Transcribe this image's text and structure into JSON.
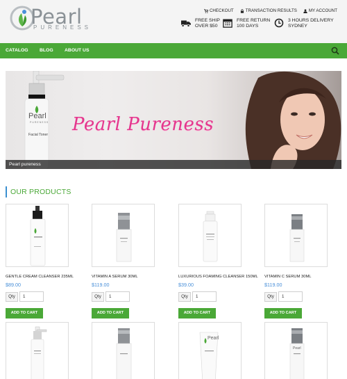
{
  "brand": {
    "name": "Pearl",
    "tagline": "PURENESS",
    "colors": {
      "green": "#4aa837",
      "price_blue": "#4a90d9",
      "banner_pink": "#e4368d"
    }
  },
  "top_links": [
    {
      "icon": "cart-icon",
      "label": "CHECKOUT"
    },
    {
      "icon": "lock-icon",
      "label": "TRANSACTION RESULTS"
    },
    {
      "icon": "user-icon",
      "label": "MY ACCOUNT"
    }
  ],
  "perks": [
    {
      "icon": "truck-icon",
      "line1": "FREE SHIP",
      "line2": "OVER $50"
    },
    {
      "icon": "calendar-icon",
      "line1": "FREE RETURN",
      "line2": "100 DAYS"
    },
    {
      "icon": "clock-icon",
      "line1": "3 HOURS DELIVERY",
      "line2": "SYDNEY"
    }
  ],
  "nav": {
    "items": [
      "CATALOG",
      "BLOG",
      "ABOUT US"
    ],
    "search_icon": "search-icon"
  },
  "banner": {
    "title": "Pearl Pureness",
    "bottle_label_brand": "Pearl",
    "bottle_label_sub": "PURENESS",
    "bottle_label_product": "Facial Toner",
    "caption": "Pearl pureness"
  },
  "section_title": "OUR PRODUCTS",
  "products": [
    {
      "name": "GENTLE CREAM CLEANSER 235ML",
      "price": "$89.00",
      "qty_label": "Qty",
      "qty_value": "1",
      "button": "ADD TO CART"
    },
    {
      "name": "VITAMIN A SERUM 30ML",
      "price": "$119.00",
      "qty_label": "Qty",
      "qty_value": "1",
      "button": "ADD TO CART"
    },
    {
      "name": "LUXURIOUS FOAMING CLEANSER 150ML",
      "price": "$39.00",
      "qty_label": "Qty",
      "qty_value": "1",
      "button": "ADD TO CART"
    },
    {
      "name": "VITAMIN C SERUM 30ML",
      "price": "$119.00",
      "qty_label": "Qty",
      "qty_value": "1",
      "button": "ADD TO CART"
    }
  ],
  "product_label_brand": "Pearl"
}
